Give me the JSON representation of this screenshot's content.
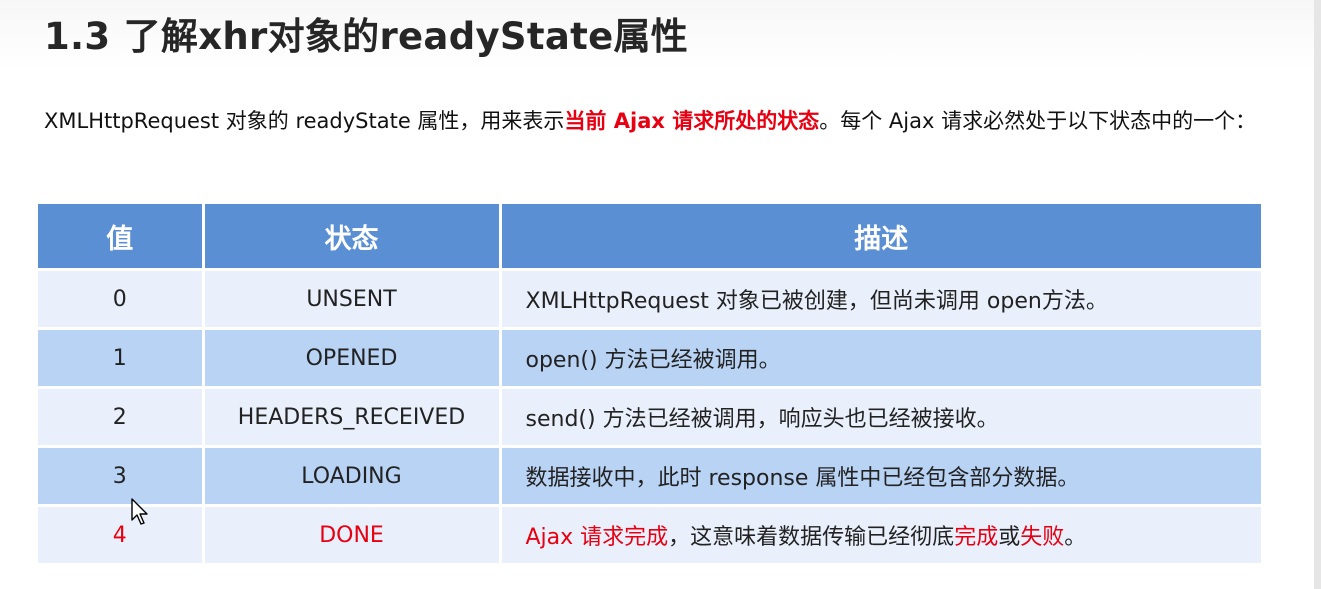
{
  "title": "1.3 了解xhr对象的readyState属性",
  "intro": {
    "part1": "XMLHttpRequest 对象的 readyState 属性，用来表示",
    "highlight": "当前 Ajax 请求所处的状态",
    "part2": "。每个 Ajax 请求必然处于以下状态中的一个："
  },
  "table": {
    "headers": [
      "值",
      "状态",
      "描述"
    ],
    "rows": [
      {
        "value": "0",
        "state": "UNSENT",
        "desc": "XMLHttpRequest 对象已被创建，但尚未调用 open方法。"
      },
      {
        "value": "1",
        "state": "OPENED",
        "desc": "open() 方法已经被调用。"
      },
      {
        "value": "2",
        "state": "HEADERS_RECEIVED",
        "desc": "send() 方法已经被调用，响应头也已经被接收。"
      },
      {
        "value": "3",
        "state": "LOADING",
        "desc": "数据接收中，此时 response 属性中已经包含部分数据。"
      }
    ],
    "done_row": {
      "value": "4",
      "state": "DONE",
      "desc_parts": [
        "Ajax 请求完成",
        "，这意味着数据传输已经彻底",
        "完成",
        "或",
        "失败",
        "。"
      ]
    }
  },
  "colors": {
    "header_bg": "#5b8fd4",
    "row_light": "#e9f0fb",
    "row_dark": "#b9d3f5",
    "highlight_red": "#e60012"
  },
  "icons": [
    "mouse-pointer-icon"
  ]
}
